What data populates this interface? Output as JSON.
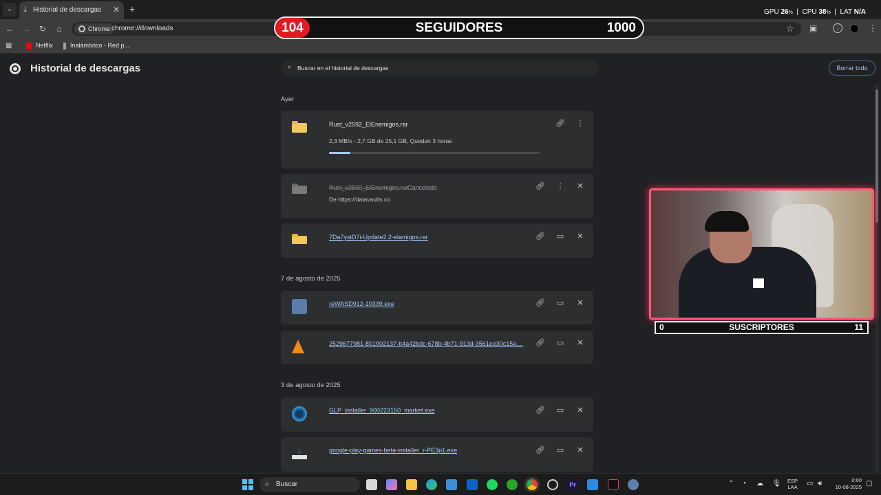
{
  "browser": {
    "tab_title": "Historial de descargas",
    "omnibox_chip": "Chrome",
    "url": "chrome://downloads",
    "bookmarks": [
      "Netflix",
      "Inalámbrico - Red p..."
    ]
  },
  "overlay": {
    "followers_count": "104",
    "followers_label": "SEGUIDORES",
    "followers_goal": "1000",
    "subscribers_count": "0",
    "subscribers_label": "SUSCRIPTORES",
    "subscribers_goal": "11",
    "stats": {
      "gpu_label": "GPU",
      "gpu_value": "26",
      "cpu_label": "CPU",
      "cpu_value": "38",
      "pct": "%",
      "lat_label": "LAT",
      "lat_value": "N/A"
    }
  },
  "page": {
    "title": "Historial de descargas",
    "search_placeholder": "Buscar en el historial de descargas",
    "clear_all": "Borrar todo"
  },
  "groups": [
    {
      "date": "Ayer",
      "items": [
        {
          "name": "Rust_v2592_ElEnemigos.rar",
          "status_line": "2,3 MB/s - 2,7 GB de 25,1 GB, Quedan 3 horas",
          "progress": 0.1,
          "icon": "folder-rar-icon"
        },
        {
          "name": "Rust_v2592_ElEnemigos.rar",
          "status": "Cancelado",
          "source": "De https://datavaults.co",
          "icon": "folder-rar-icon"
        },
        {
          "name": "7Da7ystD7i-Update2.2-elamigos.rar",
          "icon": "folder-rar-icon"
        }
      ]
    },
    {
      "date": "7 de agosto de 2025",
      "items": [
        {
          "name": "reWASD912-10339.exe",
          "icon": "installer-icon"
        },
        {
          "name": "2529677981-801902137-b4a42bdc-678b-4b71-913d-3561ee30c15a....",
          "icon": "vlc-cone-icon"
        }
      ]
    },
    {
      "date": "3 de agosto de 2025",
      "items": [
        {
          "name": "GLP_installer_900223150_market.exe",
          "icon": "glp-installer-icon"
        },
        {
          "name": "google-play-games-beta-installer_r-PE3p1.exe",
          "icon": "download-tray-icon"
        }
      ]
    }
  ],
  "taskbar": {
    "search_label": "Buscar",
    "lang": "ESP",
    "layout": "LAA",
    "time": "0:00",
    "date": "10-08-2025"
  },
  "colors": {
    "accent": "#a8c7fa",
    "overlay_red": "#e21a22",
    "webcam_border": "#ff5a7a"
  }
}
